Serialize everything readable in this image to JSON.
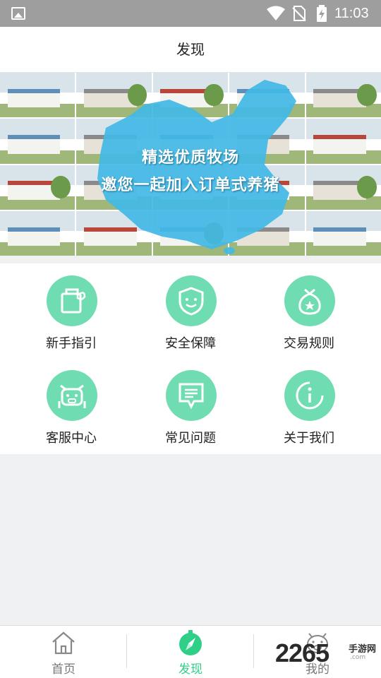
{
  "status_bar": {
    "time": "11:03",
    "icons": [
      "image-icon",
      "wifi-icon",
      "no-sim-icon",
      "battery-charging-icon"
    ]
  },
  "header": {
    "title": "发现"
  },
  "banner": {
    "line1": "精选优质牧场",
    "line2": "邀您一起加入订单式养猪"
  },
  "menu": {
    "items": [
      {
        "label": "新手指引",
        "icon": "book-leaf-icon"
      },
      {
        "label": "安全保障",
        "icon": "shield-smile-icon"
      },
      {
        "label": "交易规则",
        "icon": "money-bag-icon"
      },
      {
        "label": "客服中心",
        "icon": "pig-service-icon"
      },
      {
        "label": "常见问题",
        "icon": "chat-bubble-icon"
      },
      {
        "label": "关于我们",
        "icon": "info-icon"
      }
    ]
  },
  "tab_bar": {
    "tabs": [
      {
        "label": "首页",
        "icon": "home-icon",
        "active": false
      },
      {
        "label": "发现",
        "icon": "compass-icon",
        "active": true
      },
      {
        "label": "我的",
        "icon": "pig-face-icon",
        "active": false
      }
    ]
  },
  "watermark": {
    "number": "2265",
    "text": "手游网",
    "sub": ".com"
  },
  "colors": {
    "accent": "#2fcf88",
    "icon_bg": "#6fddb1",
    "status_bar": "#9e9e9e",
    "page_bg": "#f0f1f3"
  }
}
